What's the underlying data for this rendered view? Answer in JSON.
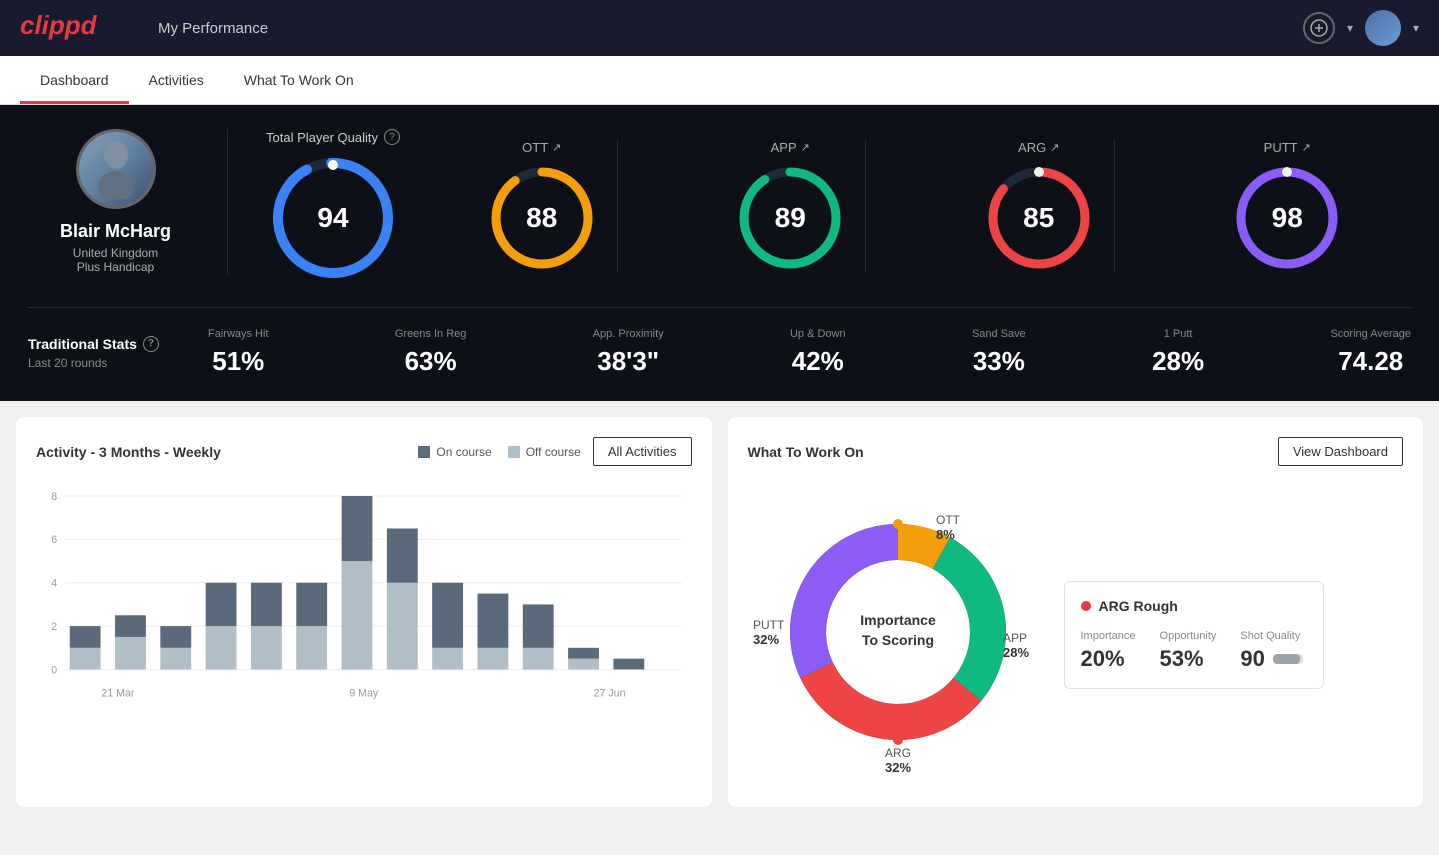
{
  "app": {
    "logo": "clippd",
    "header_title": "My Performance"
  },
  "nav": {
    "tabs": [
      {
        "label": "Dashboard",
        "active": true
      },
      {
        "label": "Activities",
        "active": false
      },
      {
        "label": "What To Work On",
        "active": false
      }
    ]
  },
  "player": {
    "name": "Blair McHarg",
    "country": "United Kingdom",
    "handicap": "Plus Handicap"
  },
  "quality": {
    "section_label": "Total Player Quality",
    "total": {
      "value": "94",
      "color": "#3b82f6"
    },
    "ott": {
      "label": "OTT",
      "value": "88",
      "color": "#f59e0b"
    },
    "app": {
      "label": "APP",
      "value": "89",
      "color": "#10b981"
    },
    "arg": {
      "label": "ARG",
      "value": "85",
      "color": "#ef4444"
    },
    "putt": {
      "label": "PUTT",
      "value": "98",
      "color": "#8b5cf6"
    }
  },
  "trad_stats": {
    "label": "Traditional Stats",
    "sublabel": "Last 20 rounds",
    "items": [
      {
        "label": "Fairways Hit",
        "value": "51%"
      },
      {
        "label": "Greens In Reg",
        "value": "63%"
      },
      {
        "label": "App. Proximity",
        "value": "38'3\""
      },
      {
        "label": "Up & Down",
        "value": "42%"
      },
      {
        "label": "Sand Save",
        "value": "33%"
      },
      {
        "label": "1 Putt",
        "value": "28%"
      },
      {
        "label": "Scoring Average",
        "value": "74.28"
      }
    ]
  },
  "activity_chart": {
    "title": "Activity - 3 Months - Weekly",
    "legend": {
      "on_course": "On course",
      "off_course": "Off course"
    },
    "all_activities_btn": "All Activities",
    "y_axis": [
      "0",
      "2",
      "4",
      "6",
      "8"
    ],
    "x_labels": [
      "21 Mar",
      "9 May",
      "27 Jun"
    ],
    "bars": [
      {
        "on": 1,
        "off": 1
      },
      {
        "on": 1.5,
        "off": 0.5
      },
      {
        "on": 1,
        "off": 0.5
      },
      {
        "on": 2,
        "off": 2
      },
      {
        "on": 2,
        "off": 1.5
      },
      {
        "on": 2,
        "off": 2
      },
      {
        "on": 3.5,
        "off": 5
      },
      {
        "on": 2.5,
        "off": 4
      },
      {
        "on": 3,
        "off": 1
      },
      {
        "on": 2.5,
        "off": 1
      },
      {
        "on": 2,
        "off": 1
      },
      {
        "on": 0.5,
        "off": 0.5
      },
      {
        "on": 0.5,
        "off": 0
      }
    ]
  },
  "work_on": {
    "title": "What To Work On",
    "view_dashboard_btn": "View Dashboard",
    "donut_center_line1": "Importance",
    "donut_center_line2": "To Scoring",
    "segments": [
      {
        "label": "OTT",
        "value": "8%",
        "color": "#f59e0b",
        "position": "top"
      },
      {
        "label": "APP",
        "value": "28%",
        "color": "#10b981",
        "position": "right"
      },
      {
        "label": "ARG",
        "value": "32%",
        "color": "#ef4444",
        "position": "bottom"
      },
      {
        "label": "PUTT",
        "value": "32%",
        "color": "#8b5cf6",
        "position": "left"
      }
    ],
    "arg_rough": {
      "title": "ARG Rough",
      "dot_color": "#ef4444",
      "metrics": [
        {
          "label": "Importance",
          "value": "20%"
        },
        {
          "label": "Opportunity",
          "value": "53%"
        },
        {
          "label": "Shot Quality",
          "value": "90"
        }
      ]
    }
  }
}
